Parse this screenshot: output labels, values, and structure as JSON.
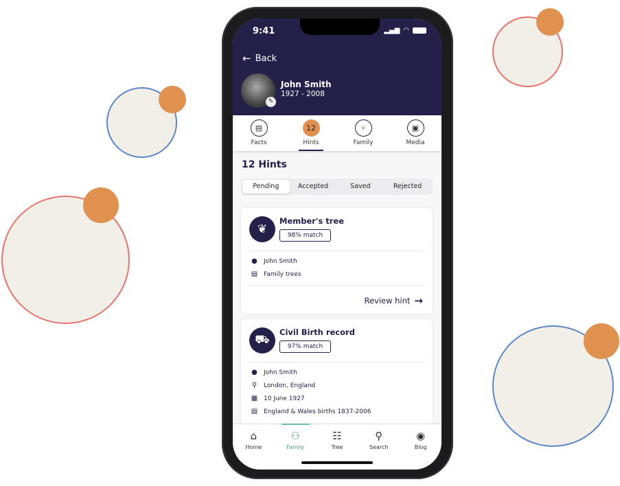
{
  "status_bar": {
    "time": "9:41"
  },
  "header": {
    "back_label": "Back",
    "person_name": "John Smith",
    "person_dates": "1927 - 2008"
  },
  "tabs": [
    {
      "label": "Facts",
      "icon": "document-icon"
    },
    {
      "label": "Hints",
      "badge": "12"
    },
    {
      "label": "Family",
      "icon": "family-icon"
    },
    {
      "label": "Media",
      "icon": "media-icon"
    }
  ],
  "hints_title": "12 Hints",
  "filters": [
    "Pending",
    "Accepted",
    "Saved",
    "Rejected"
  ],
  "cards": [
    {
      "title": "Member's tree",
      "match": "98% match",
      "icon": "tree-icon",
      "rows": [
        {
          "icon": "person-icon",
          "text": "John Smith"
        },
        {
          "icon": "document-icon",
          "text": "Family trees"
        }
      ],
      "action": "Review hint"
    },
    {
      "title": "Civil Birth record",
      "match": "97% match",
      "icon": "pram-icon",
      "rows": [
        {
          "icon": "person-icon",
          "text": "John Smith"
        },
        {
          "icon": "location-icon",
          "text": "London, England"
        },
        {
          "icon": "calendar-icon",
          "text": "10 June 1927"
        },
        {
          "icon": "document-icon",
          "text": "England & Wales births 1837-2006"
        }
      ]
    }
  ],
  "bottom_nav": [
    {
      "label": "Home"
    },
    {
      "label": "Family",
      "active": true
    },
    {
      "label": "Tree"
    },
    {
      "label": "Search"
    },
    {
      "label": "Blog"
    }
  ],
  "colors": {
    "navy": "#252049",
    "orange": "#e0904f",
    "green": "#4c9f7a",
    "blue_line": "#5b86c9",
    "red_line": "#e6736b"
  }
}
